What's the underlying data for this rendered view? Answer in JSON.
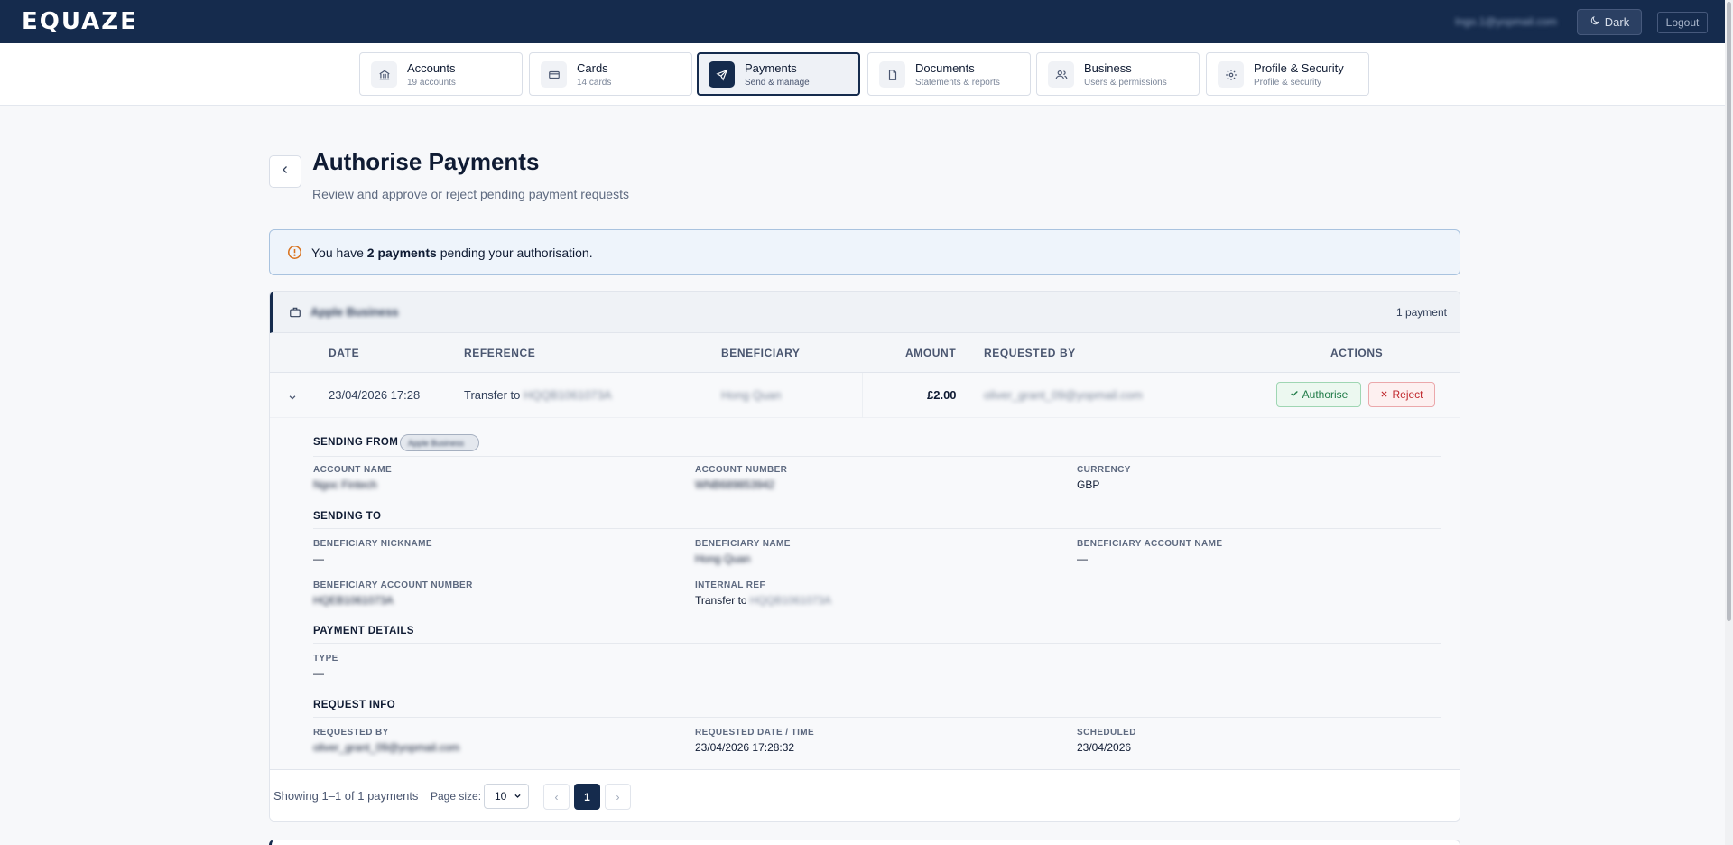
{
  "app": {
    "brand": "EQUAZE",
    "user_email": "Ingo.1@yopmail.com",
    "theme_toggle_label": "Dark",
    "logout_label": "Logout"
  },
  "nav": [
    {
      "title": "Accounts",
      "subtitle": "19 accounts",
      "icon": "bank-icon",
      "active": false
    },
    {
      "title": "Cards",
      "subtitle": "14 cards",
      "icon": "credit-card-icon",
      "active": false
    },
    {
      "title": "Payments",
      "subtitle": "Send & manage",
      "icon": "send-icon",
      "active": true
    },
    {
      "title": "Documents",
      "subtitle": "Statements & reports",
      "icon": "document-icon",
      "active": false
    },
    {
      "title": "Business",
      "subtitle": "Users & permissions",
      "icon": "users-icon",
      "active": false
    },
    {
      "title": "Profile & Security",
      "subtitle": "Profile & security",
      "icon": "gear-icon",
      "active": false
    }
  ],
  "page": {
    "title": "Authorise Payments",
    "subtitle": "Review and approve or reject pending payment requests"
  },
  "alert": {
    "prefix": "You have ",
    "count": "2 payments",
    "suffix": " pending your authorisation."
  },
  "group": {
    "name": "Apple Business",
    "count_label": "1 payment",
    "columns": [
      "DATE",
      "REFERENCE",
      "BENEFICIARY",
      "AMOUNT",
      "REQUESTED BY",
      "ACTIONS"
    ],
    "row": {
      "date": "23/04/2026 17:28",
      "reference_prefix": "Transfer to",
      "reference_code": "HQQB1061073A",
      "beneficiary": "Hong Quan",
      "amount": "£2.00",
      "requested_by": "oliver_grant_09@yopmail.com",
      "authorise_label": "Authorise",
      "reject_label": "Reject"
    },
    "detail": {
      "sending_from": {
        "title": "SENDING FROM",
        "chip": "Apple Business",
        "fields": [
          {
            "label": "ACCOUNT NAME",
            "value": "Ngoc Fintech"
          },
          {
            "label": "ACCOUNT NUMBER",
            "value": "WNB689853942"
          },
          {
            "label": "CURRENCY",
            "value": "GBP"
          }
        ]
      },
      "sending_to": {
        "title": "SENDING TO",
        "fields": [
          {
            "label": "BENEFICIARY NICKNAME",
            "value": "—"
          },
          {
            "label": "BENEFICIARY NAME",
            "value": "Hong Quan"
          },
          {
            "label": "BENEFICIARY ACCOUNT NAME",
            "value": "—"
          },
          {
            "label": "BENEFICIARY ACCOUNT NUMBER",
            "value": "HQEB1061073A"
          },
          {
            "label": "INTERNAL REF",
            "value_prefix": "Transfer to",
            "value_code": "HQQB1061073A"
          }
        ]
      },
      "payment_details": {
        "title": "PAYMENT DETAILS",
        "fields": [
          {
            "label": "TYPE",
            "value": "—"
          }
        ]
      },
      "request_info": {
        "title": "REQUEST INFO",
        "fields": [
          {
            "label": "REQUESTED BY",
            "value": "oliver_grant_09@yopmail.com"
          },
          {
            "label": "REQUESTED DATE / TIME",
            "value": "23/04/2026 17:28:32"
          },
          {
            "label": "SCHEDULED",
            "value": "23/04/2026"
          }
        ]
      }
    },
    "footer": {
      "showing": "Showing 1–1 of 1 payments",
      "page_size_label": "Page size:",
      "page_size_value": "10",
      "prev": "‹",
      "current_page": "1",
      "next": "›"
    }
  }
}
